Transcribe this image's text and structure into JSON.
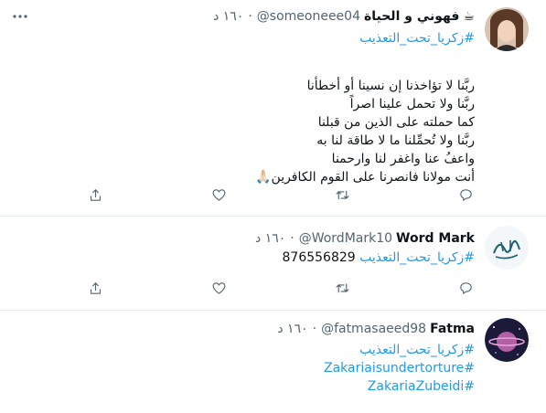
{
  "tweets": [
    {
      "name": "فهوني و الحياة",
      "name_emoji": "☕",
      "handle": "@someoneee04",
      "dot": "·",
      "time": "١٦٠ د",
      "hashtag": "#زكريا_تحت_التعذيب",
      "lines": [
        "ربَّنا لا تؤاخذنا إن نسينا أو أخطأنا",
        "ربَّنا ولا تحمل علينا اصراً",
        "كما حملته على الذين من قبلنا",
        "ربَّنا ولا تُحمِّلنا ما لا طاقة لنا به",
        "واعفُ عنا واغفر لنا وارحمنا",
        "أنت مولانا فانصرنا على القوم الكافرين"
      ],
      "last_line_emoji": "🙏🏻"
    },
    {
      "name": "Word Mark",
      "handle": "@WordMark10",
      "dot": "·",
      "time": "١٦٠ د",
      "hashtag": "#زكريا_تحت_التعذيب",
      "number": "876556829"
    },
    {
      "name": "Fatma",
      "handle": "@fatmasaeed98",
      "dot": "·",
      "time": "١٦٠ د",
      "hashtag": "#زكريا_تحت_التعذيب",
      "hashtags_en": [
        "#Zakariaisundertorture",
        "#ZakariaZubeidi"
      ]
    }
  ],
  "icons": {
    "reply": "reply-icon",
    "retweet": "retweet-icon",
    "like": "like-icon",
    "share": "share-icon",
    "more": "more-icon"
  },
  "colors": {
    "hashtag": "#1d9bf0",
    "secondary_text": "#536471",
    "divider": "#e6ecf0"
  }
}
